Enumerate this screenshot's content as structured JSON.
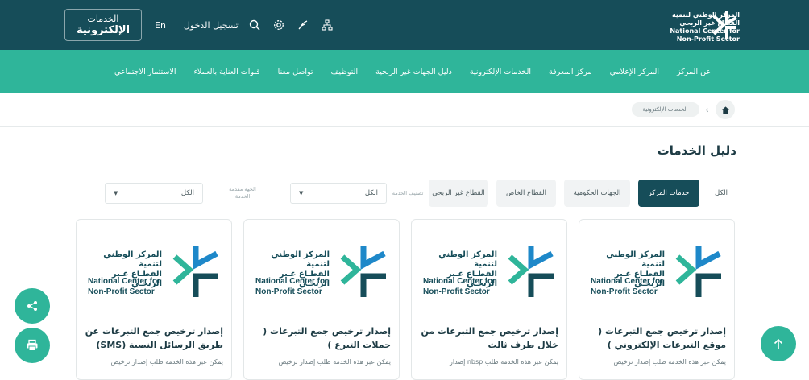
{
  "header": {
    "brand_lines": [
      "المركز الوطني لتنمية",
      "القطاع غير الربحي",
      "National Center for",
      "Non-Profit Sector"
    ],
    "eservices_line1": "الخدمات",
    "eservices_line2": "الإلكترونية",
    "lang": "En",
    "login": "تسجيل الدخول"
  },
  "nav": {
    "items": [
      "عن المركز",
      "المركز الإعلامي",
      "مركز المعرفة",
      "الخدمات الإلكترونية",
      "دليل الجهات غير الربحية",
      "التوظيف",
      "تواصل معنا",
      "قنوات العناية بالعملاء",
      "الاستثمار الاجتماعي"
    ]
  },
  "breadcrumb": {
    "current": "الخدمات الإلكترونية"
  },
  "page": {
    "title": "دليل الخدمات"
  },
  "filters": {
    "chips": [
      "الكل",
      "خدمات المركز",
      "الجهات الحكومية",
      "القطاع الخاص",
      "القطاع غير الربحي"
    ],
    "active_index": 1,
    "classification_label": "تصنيف الخدمة",
    "classification_value": "الكل",
    "provider_label": "الجهة مقدمة الخدمة",
    "provider_value": "الكل"
  },
  "cards": [
    {
      "logo_ar": [
        "المركز الوطني لتنمية",
        "القطـاع غـير الربحـي"
      ],
      "logo_en": [
        "National Center for",
        "Non-Profit Sector"
      ],
      "title": "إصدار ترخيص جمع التبرعات ( موقع التبرعات الإلكتروني )",
      "desc": "يمكن عبر هذه الخدمة طلب إصدار ترخيص"
    },
    {
      "logo_ar": [
        "المركز الوطني لتنمية",
        "القطـاع غـير الربحـي"
      ],
      "logo_en": [
        "National Center for",
        "Non-Profit Sector"
      ],
      "title": "إصدار ترخيص جمع التبرعات من خلال طرف ثالث",
      "desc": "يمكن عبر هذه الخدمة طلب nbsp إصدار"
    },
    {
      "logo_ar": [
        "المركز الوطني لتنمية",
        "القطـاع غـير الربحـي"
      ],
      "logo_en": [
        "National Center for",
        "Non-Profit Sector"
      ],
      "title": "إصدار ترخيص جمع التبرعات ( حملات التبرع )",
      "desc": "يمكن عبر هذه الخدمة طلب إصدار ترخيص"
    },
    {
      "logo_ar": [
        "المركز الوطني لتنمية",
        "القطـاع غـير الربحـي"
      ],
      "logo_en": [
        "National Center for",
        "Non-Profit Sector"
      ],
      "title": "إصدار ترخيص جمع التبرعات عن طريق الرسائل النصية (SMS)",
      "desc": "يمكن عبر هذه الخدمة طلب إصدار ترخيص"
    }
  ],
  "colors": {
    "dark": "#164d59",
    "accent": "#2fb59a",
    "logo_blue": "#1e88c9"
  }
}
